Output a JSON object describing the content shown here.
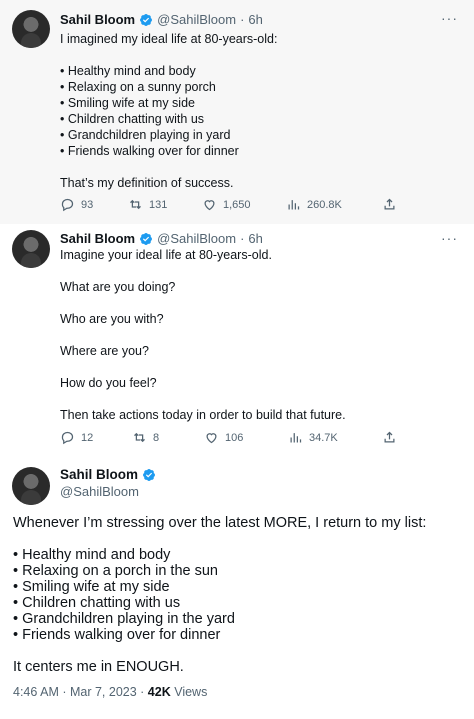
{
  "colors": {
    "verified_blue": "#1d9bf0",
    "muted": "#536471",
    "text": "#0f1419",
    "highlight_bg": "#f7f7f7"
  },
  "tweet1": {
    "name": "Sahil Bloom",
    "handle": "@SahilBloom",
    "dot": "·",
    "time": "6h",
    "more": "···",
    "lines": [
      "I imagined my ideal life at 80-years-old:",
      "",
      "• Healthy mind and body",
      "• Relaxing on a sunny porch",
      "• Smiling wife at my side",
      "• Children chatting with us",
      "• Grandchildren playing in yard",
      "• Friends walking over for dinner",
      "",
      "That’s my definition of success."
    ],
    "replies": "93",
    "retweets": "131",
    "likes": "1,650",
    "views": "260.8K"
  },
  "tweet2": {
    "name": "Sahil Bloom",
    "handle": "@SahilBloom",
    "dot": "·",
    "time": "6h",
    "more": "···",
    "lines": [
      "Imagine your ideal life at 80-years-old.",
      "",
      "What are you doing?",
      "",
      "Who are you with?",
      "",
      "Where are you?",
      "",
      "How do you feel?",
      "",
      "Then take actions today in order to build that future."
    ],
    "replies": "12",
    "retweets": "8",
    "likes": "106",
    "views": "34.7K"
  },
  "tweet3": {
    "name": "Sahil Bloom",
    "handle": "@SahilBloom",
    "lines": [
      "Whenever I’m stressing over the latest MORE, I return to my list:",
      "",
      "• Healthy mind and body",
      "• Relaxing on a porch in the sun",
      "• Smiling wife at my side",
      "• Children chatting with us",
      "• Grandchildren playing in the yard",
      "• Friends walking over for dinner",
      "",
      "It centers me in ENOUGH."
    ],
    "timestamp": "4:46 AM · Mar 7, 2023 · ",
    "views_count": "42K",
    "views_label": " Views"
  }
}
